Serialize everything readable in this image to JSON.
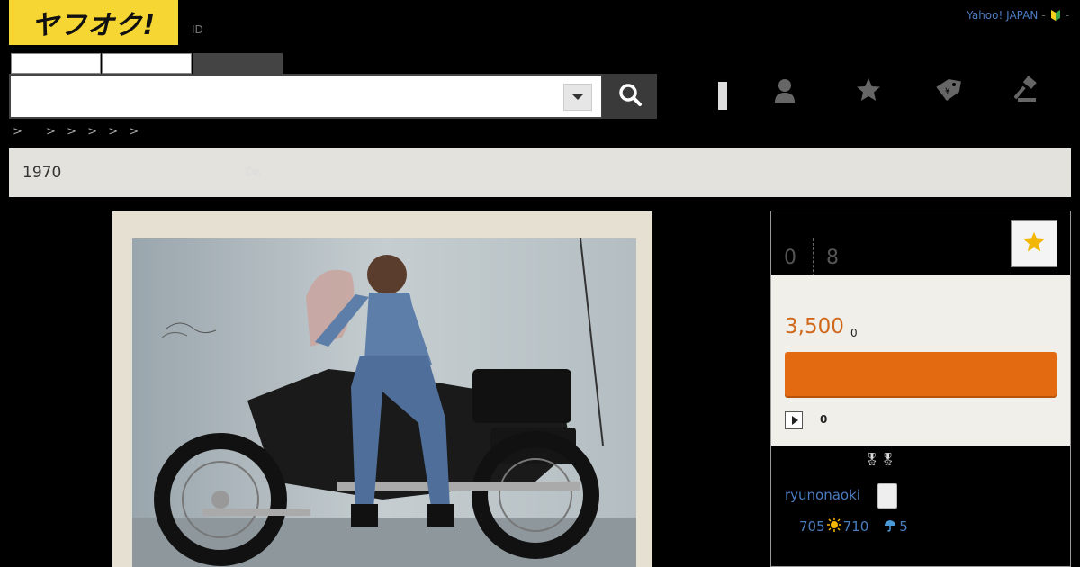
{
  "header": {
    "logo_text": "ヤフオク!",
    "id_link": "ID",
    "top_links": {
      "yahoo_japan": "Yahoo! JAPAN",
      "separator": "-",
      "separator2": "-"
    },
    "search": {
      "value": "",
      "placeholder": ""
    },
    "icons": [
      "notification-bar",
      "user-icon",
      "star-icon",
      "tag-icon",
      "gavel-icon"
    ]
  },
  "breadcrumb": [
    ">",
    ">",
    ">",
    ">",
    ">",
    ">"
  ],
  "item": {
    "title": "1970",
    "title_icon": "🏍"
  },
  "panel": {
    "bid_count": "0",
    "watch_count": "8",
    "price": "3,500",
    "tax_note": "0",
    "autoplay_count": "0"
  },
  "seller": {
    "badge": "🎖🎖",
    "name": "ryunonaoki",
    "rating_total": "705",
    "rating_good": "710",
    "rating_bad": "5"
  },
  "colors": {
    "logo_bg": "#f5d633",
    "price": "#d0681c",
    "bid_button": "#e36a10",
    "link": "#4a7cc0",
    "title_bar": "#e3e2dc"
  }
}
